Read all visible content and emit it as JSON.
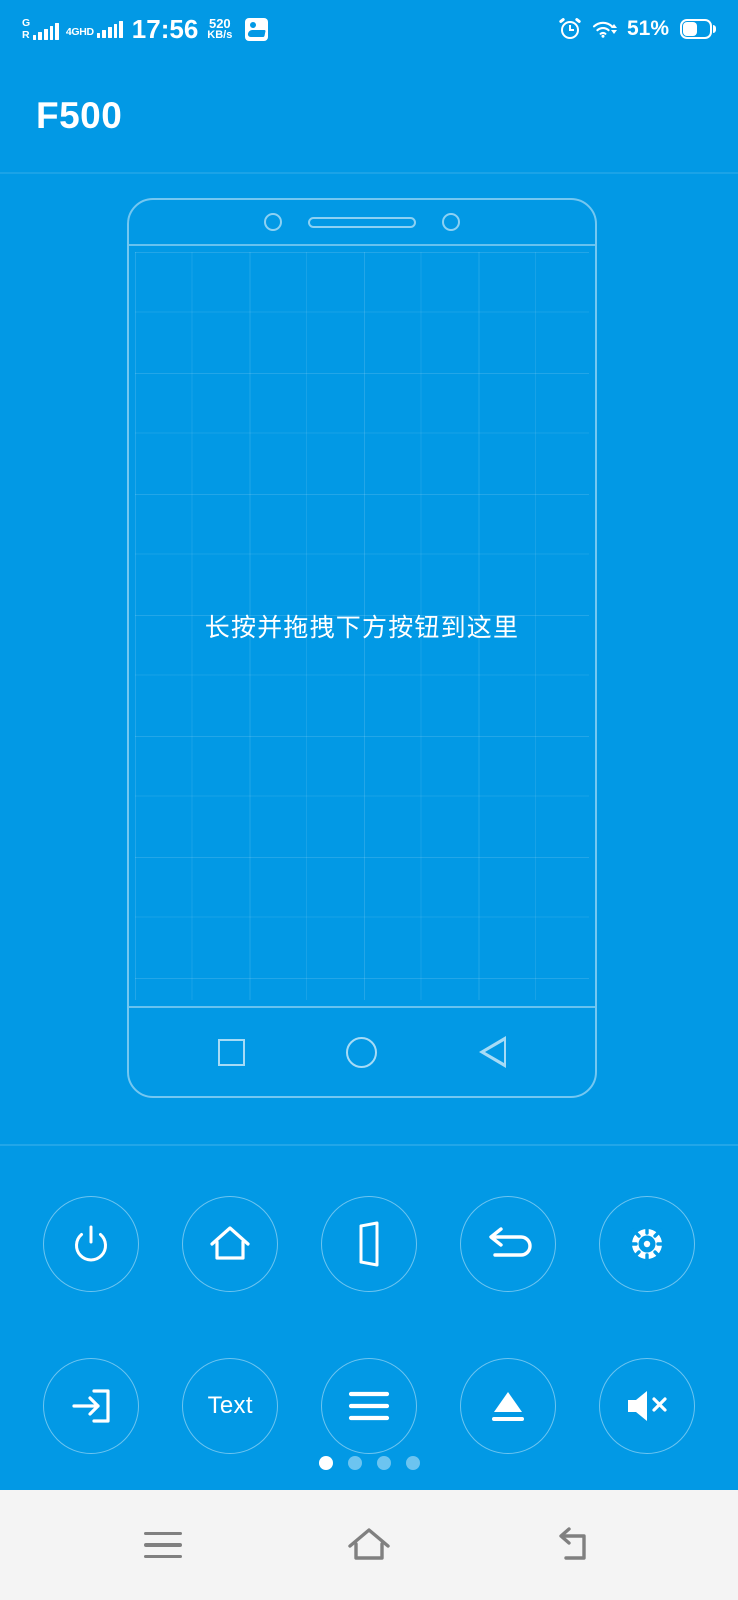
{
  "status_bar": {
    "signal_1_label_top": "G",
    "signal_1_label_bottom": "R",
    "signal_2_label": "4GHD",
    "time": "17:56",
    "data_rate_value": "520",
    "data_rate_unit": "KB/s",
    "app_icon_name": "notification-app-icon",
    "alarm_icon_name": "alarm-icon",
    "wifi_icon_name": "wifi-icon",
    "battery_percent": "51%",
    "battery_icon_name": "battery-icon"
  },
  "app_bar": {
    "title": "F500"
  },
  "preview": {
    "drop_hint": "长按并拖拽下方按钮到这里",
    "phone_nav": [
      {
        "name": "recents-square-icon",
        "label": ""
      },
      {
        "name": "home-circle-icon",
        "label": ""
      },
      {
        "name": "back-triangle-icon",
        "label": ""
      }
    ]
  },
  "button_panel": {
    "rows": [
      [
        {
          "name": "power-button",
          "icon": "power-icon",
          "label": ""
        },
        {
          "name": "home-button",
          "icon": "home-icon",
          "label": ""
        },
        {
          "name": "exit-button",
          "icon": "door-icon",
          "label": ""
        },
        {
          "name": "back-button",
          "icon": "back-arrow-icon",
          "label": ""
        },
        {
          "name": "settings-button",
          "icon": "gear-icon",
          "label": ""
        }
      ],
      [
        {
          "name": "input-source-button",
          "icon": "input-arrow-icon",
          "label": ""
        },
        {
          "name": "text-button",
          "icon": "text-label",
          "label": "Text"
        },
        {
          "name": "menu-button",
          "icon": "hamburger-icon",
          "label": ""
        },
        {
          "name": "eject-button",
          "icon": "eject-icon",
          "label": ""
        },
        {
          "name": "mute-button",
          "icon": "mute-speaker-icon",
          "label": ""
        }
      ]
    ],
    "pages": {
      "count": 4,
      "active_index": 0
    }
  },
  "system_nav": {
    "items": [
      {
        "name": "system-menu-icon"
      },
      {
        "name": "system-home-icon"
      },
      {
        "name": "system-back-icon"
      }
    ]
  },
  "colors": {
    "primary_blue": "#0299e5",
    "status_text": "#ffffff",
    "outline": "rgba(255,255,255,0.45)",
    "sysnav_bg": "#f4f4f4",
    "sysnav_icon": "#808080"
  }
}
